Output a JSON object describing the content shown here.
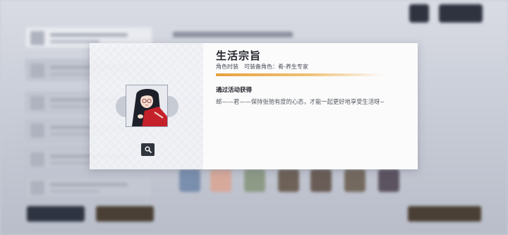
{
  "dialog": {
    "title": "生活宗旨",
    "category": "角色时装",
    "equip_label": "可装备角色：",
    "equip_character": "肴-养生专家",
    "source_heading": "通过活动获得",
    "description": "邮——君——保持张弛有度的心态，才能一起更好地享受生活呀~",
    "accent_color": "#e9a13d",
    "zoom_icon": "magnifier-icon"
  }
}
